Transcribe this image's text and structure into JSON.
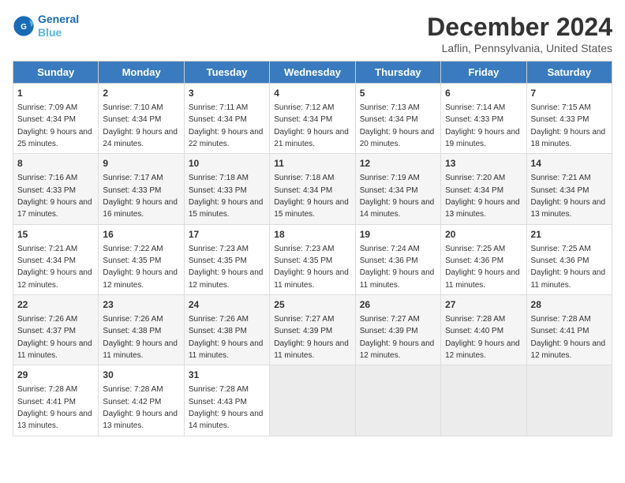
{
  "header": {
    "logo_line1": "General",
    "logo_line2": "Blue",
    "month_title": "December 2024",
    "location": "Laflin, Pennsylvania, United States"
  },
  "days_of_week": [
    "Sunday",
    "Monday",
    "Tuesday",
    "Wednesday",
    "Thursday",
    "Friday",
    "Saturday"
  ],
  "weeks": [
    [
      {
        "day": "1",
        "info": "Sunrise: 7:09 AM\nSunset: 4:34 PM\nDaylight: 9 hours and 25 minutes."
      },
      {
        "day": "2",
        "info": "Sunrise: 7:10 AM\nSunset: 4:34 PM\nDaylight: 9 hours and 24 minutes."
      },
      {
        "day": "3",
        "info": "Sunrise: 7:11 AM\nSunset: 4:34 PM\nDaylight: 9 hours and 22 minutes."
      },
      {
        "day": "4",
        "info": "Sunrise: 7:12 AM\nSunset: 4:34 PM\nDaylight: 9 hours and 21 minutes."
      },
      {
        "day": "5",
        "info": "Sunrise: 7:13 AM\nSunset: 4:34 PM\nDaylight: 9 hours and 20 minutes."
      },
      {
        "day": "6",
        "info": "Sunrise: 7:14 AM\nSunset: 4:33 PM\nDaylight: 9 hours and 19 minutes."
      },
      {
        "day": "7",
        "info": "Sunrise: 7:15 AM\nSunset: 4:33 PM\nDaylight: 9 hours and 18 minutes."
      }
    ],
    [
      {
        "day": "8",
        "info": "Sunrise: 7:16 AM\nSunset: 4:33 PM\nDaylight: 9 hours and 17 minutes."
      },
      {
        "day": "9",
        "info": "Sunrise: 7:17 AM\nSunset: 4:33 PM\nDaylight: 9 hours and 16 minutes."
      },
      {
        "day": "10",
        "info": "Sunrise: 7:18 AM\nSunset: 4:33 PM\nDaylight: 9 hours and 15 minutes."
      },
      {
        "day": "11",
        "info": "Sunrise: 7:18 AM\nSunset: 4:34 PM\nDaylight: 9 hours and 15 minutes."
      },
      {
        "day": "12",
        "info": "Sunrise: 7:19 AM\nSunset: 4:34 PM\nDaylight: 9 hours and 14 minutes."
      },
      {
        "day": "13",
        "info": "Sunrise: 7:20 AM\nSunset: 4:34 PM\nDaylight: 9 hours and 13 minutes."
      },
      {
        "day": "14",
        "info": "Sunrise: 7:21 AM\nSunset: 4:34 PM\nDaylight: 9 hours and 13 minutes."
      }
    ],
    [
      {
        "day": "15",
        "info": "Sunrise: 7:21 AM\nSunset: 4:34 PM\nDaylight: 9 hours and 12 minutes."
      },
      {
        "day": "16",
        "info": "Sunrise: 7:22 AM\nSunset: 4:35 PM\nDaylight: 9 hours and 12 minutes."
      },
      {
        "day": "17",
        "info": "Sunrise: 7:23 AM\nSunset: 4:35 PM\nDaylight: 9 hours and 12 minutes."
      },
      {
        "day": "18",
        "info": "Sunrise: 7:23 AM\nSunset: 4:35 PM\nDaylight: 9 hours and 11 minutes."
      },
      {
        "day": "19",
        "info": "Sunrise: 7:24 AM\nSunset: 4:36 PM\nDaylight: 9 hours and 11 minutes."
      },
      {
        "day": "20",
        "info": "Sunrise: 7:25 AM\nSunset: 4:36 PM\nDaylight: 9 hours and 11 minutes."
      },
      {
        "day": "21",
        "info": "Sunrise: 7:25 AM\nSunset: 4:36 PM\nDaylight: 9 hours and 11 minutes."
      }
    ],
    [
      {
        "day": "22",
        "info": "Sunrise: 7:26 AM\nSunset: 4:37 PM\nDaylight: 9 hours and 11 minutes."
      },
      {
        "day": "23",
        "info": "Sunrise: 7:26 AM\nSunset: 4:38 PM\nDaylight: 9 hours and 11 minutes."
      },
      {
        "day": "24",
        "info": "Sunrise: 7:26 AM\nSunset: 4:38 PM\nDaylight: 9 hours and 11 minutes."
      },
      {
        "day": "25",
        "info": "Sunrise: 7:27 AM\nSunset: 4:39 PM\nDaylight: 9 hours and 11 minutes."
      },
      {
        "day": "26",
        "info": "Sunrise: 7:27 AM\nSunset: 4:39 PM\nDaylight: 9 hours and 12 minutes."
      },
      {
        "day": "27",
        "info": "Sunrise: 7:28 AM\nSunset: 4:40 PM\nDaylight: 9 hours and 12 minutes."
      },
      {
        "day": "28",
        "info": "Sunrise: 7:28 AM\nSunset: 4:41 PM\nDaylight: 9 hours and 12 minutes."
      }
    ],
    [
      {
        "day": "29",
        "info": "Sunrise: 7:28 AM\nSunset: 4:41 PM\nDaylight: 9 hours and 13 minutes."
      },
      {
        "day": "30",
        "info": "Sunrise: 7:28 AM\nSunset: 4:42 PM\nDaylight: 9 hours and 13 minutes."
      },
      {
        "day": "31",
        "info": "Sunrise: 7:28 AM\nSunset: 4:43 PM\nDaylight: 9 hours and 14 minutes."
      },
      {
        "day": "",
        "info": ""
      },
      {
        "day": "",
        "info": ""
      },
      {
        "day": "",
        "info": ""
      },
      {
        "day": "",
        "info": ""
      }
    ]
  ]
}
